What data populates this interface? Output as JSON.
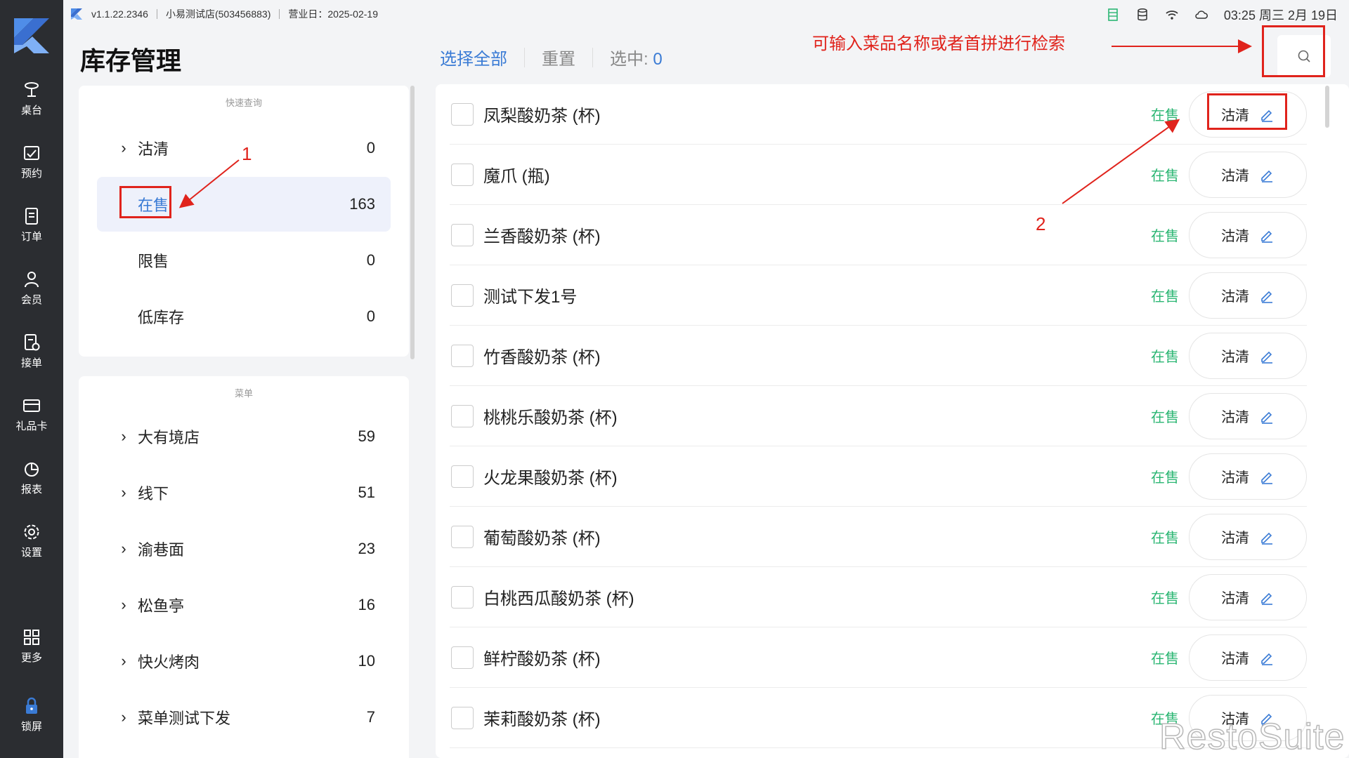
{
  "topbar": {
    "version": "v1.1.22.2346",
    "store": "小易测试店(503456883)",
    "business_day": "营业日：2025-02-19",
    "clock": "03:25 周三 2月 19日"
  },
  "nav": [
    {
      "label": "桌台",
      "icon": "table-icon"
    },
    {
      "label": "预约",
      "icon": "reservation-icon"
    },
    {
      "label": "订单",
      "icon": "order-icon"
    },
    {
      "label": "会员",
      "icon": "member-icon"
    },
    {
      "label": "接单",
      "icon": "accept-order-icon"
    },
    {
      "label": "礼品卡",
      "icon": "gift-card-icon"
    },
    {
      "label": "报表",
      "icon": "report-icon"
    },
    {
      "label": "设置",
      "icon": "settings-icon"
    },
    {
      "label": "更多",
      "icon": "more-icon"
    },
    {
      "label": "锁屏",
      "icon": "lock-icon"
    }
  ],
  "header": {
    "title": "库存管理",
    "select_all": "选择全部",
    "reset": "重置",
    "selected_label": "选中:",
    "selected_count": "0",
    "hint": "可输入菜品名称或者首拼进行检索"
  },
  "quick_query": {
    "caption": "快速查询",
    "rows": [
      {
        "label": "沽清",
        "count": "0",
        "chevron": true
      },
      {
        "label": "在售",
        "count": "163",
        "chevron": false,
        "active": true
      },
      {
        "label": "限售",
        "count": "0",
        "chevron": false
      },
      {
        "label": "低库存",
        "count": "0",
        "chevron": false
      }
    ]
  },
  "menu": {
    "caption": "菜单",
    "rows": [
      {
        "label": "大有境店",
        "count": "59"
      },
      {
        "label": "线下",
        "count": "51"
      },
      {
        "label": "渝巷面",
        "count": "23"
      },
      {
        "label": "松鱼亭",
        "count": "16"
      },
      {
        "label": "快火烤肉",
        "count": "10"
      },
      {
        "label": "菜单测试下发",
        "count": "7"
      }
    ]
  },
  "items": [
    {
      "name": "凤梨酸奶茶 (杯)",
      "status": "在售",
      "action": "沽清"
    },
    {
      "name": "魔爪 (瓶)",
      "status": "在售",
      "action": "沽清"
    },
    {
      "name": "兰香酸奶茶 (杯)",
      "status": "在售",
      "action": "沽清"
    },
    {
      "name": "测试下发1号",
      "status": "在售",
      "action": "沽清"
    },
    {
      "name": "竹香酸奶茶 (杯)",
      "status": "在售",
      "action": "沽清"
    },
    {
      "name": "桃桃乐酸奶茶 (杯)",
      "status": "在售",
      "action": "沽清"
    },
    {
      "name": "火龙果酸奶茶 (杯)",
      "status": "在售",
      "action": "沽清"
    },
    {
      "name": "葡萄酸奶茶 (杯)",
      "status": "在售",
      "action": "沽清"
    },
    {
      "name": "白桃西瓜酸奶茶 (杯)",
      "status": "在售",
      "action": "沽清"
    },
    {
      "name": "鲜柠酸奶茶 (杯)",
      "status": "在售",
      "action": "沽清"
    },
    {
      "name": "茉莉酸奶茶 (杯)",
      "status": "在售",
      "action": "沽清"
    }
  ],
  "annotations": {
    "one": "1",
    "two": "2"
  },
  "watermark": "RestoSuite",
  "colors": {
    "accent": "#3a7bd5",
    "on_sale": "#2bb673",
    "annotation": "#e0231c",
    "nav_bg": "#2b2d31"
  }
}
